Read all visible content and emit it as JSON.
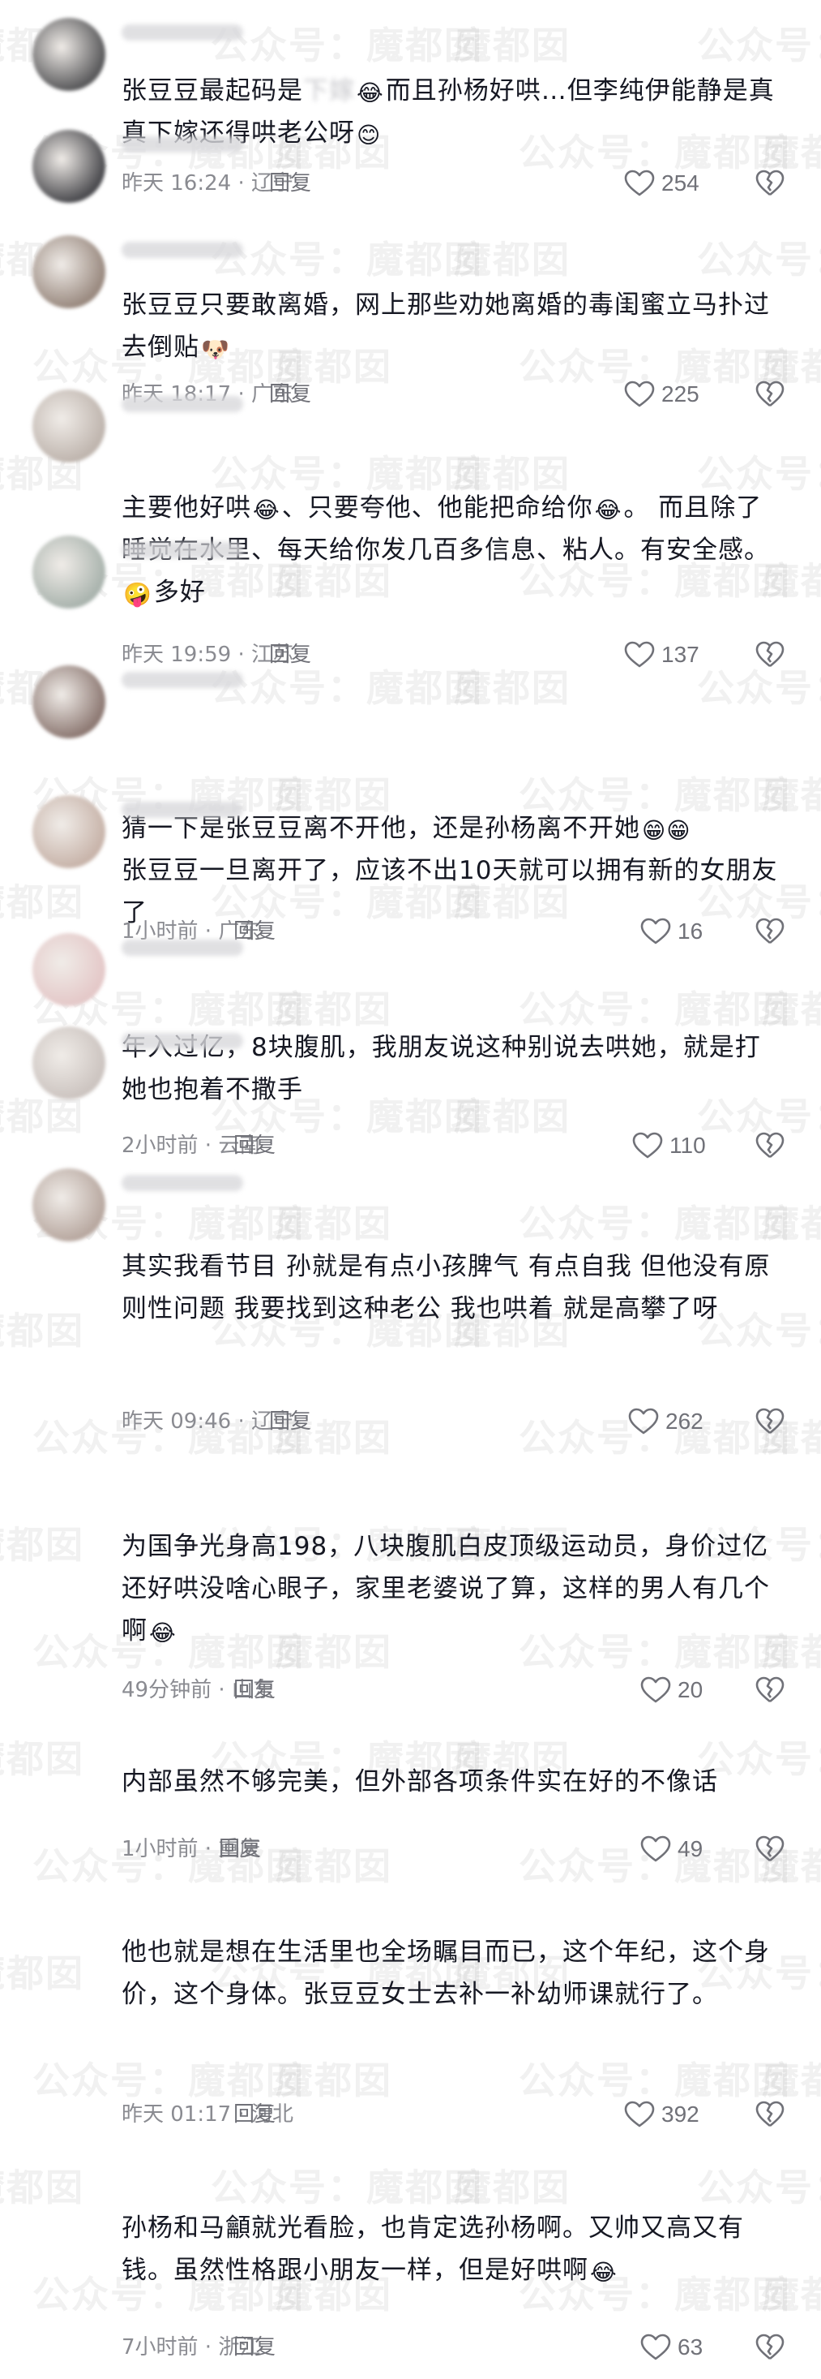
{
  "colors": {
    "text": "#161823",
    "meta": "#8a8b91",
    "icon": "#707178"
  },
  "watermark": [
    "魔都囡",
    "公众号：魔都囡"
  ],
  "comments": [
    {
      "text_parts": [
        "张豆豆最起码是",
        "下嫁",
        "😂",
        "而且孙杨好哄…但李纯伊能静是真真下嫁还得哄老公呀",
        "😊"
      ],
      "time": "昨天 16:24 · 辽宁",
      "reply": "回复",
      "likes": "254"
    },
    {
      "text_parts": [
        "张豆豆只要敢离婚，网上那些劝她离婚的毒闺蜜立马扑过去倒贴",
        "🐶"
      ],
      "time": "昨天 18:17 · 广东",
      "reply": "回复",
      "likes": "225"
    },
    {
      "text_parts": [
        "主要他好哄",
        "😂",
        "、只要夸他、他能把命给你",
        "😂",
        "。 而且除了睡觉在水里、每天给你发几百多信息、粘人。有安全感。 ",
        "🤪",
        "多好"
      ],
      "time": "昨天 19:59 · 江苏",
      "reply": "回复",
      "likes": "137"
    },
    {
      "text_parts": [
        "猜一下是张豆豆离不开他，还是孙杨离不开她",
        "😁😁",
        "\n张豆豆一旦离开了，应该不出10天就可以拥有新的女朋友了"
      ],
      "time": "1小时前 · 广东",
      "reply": "回复",
      "likes": "16"
    },
    {
      "text_parts": [
        "年入过亿，8块腹肌，我朋友说这种别说去哄她，就是打她也抱着不撒手"
      ],
      "time": "2小时前 · 云南",
      "reply": "回复",
      "likes": "110"
    },
    {
      "text_parts": [
        "其实我看节目 孙就是有点小孩脾气 有点自我 但他没有原则性问题 我要找到这种老公 我也哄着 就是高攀了呀"
      ],
      "time": "昨天 09:46 · 辽宁",
      "reply": "回复",
      "likes": "262"
    },
    {
      "text_parts": [
        "为国争光身高198，八块腹肌白皮顶级运动员，身价过亿还好哄没啥心眼子，家里老婆说了算，这样的男人有几个啊",
        "😂"
      ],
      "time": "49分钟前 · 山东",
      "reply": "回复",
      "likes": "20"
    },
    {
      "text_parts": [
        "内部虽然不够完美，但外部各项条件实在好的不像话"
      ],
      "time": "1小时前 · 重庆",
      "reply": "回复",
      "likes": "49"
    },
    {
      "text_parts": [
        "他也就是想在生活里也全场瞩目而已，这个年纪，这个身价，这个身体。张豆豆女士去补一补幼师课就行了。"
      ],
      "time": "昨天 01:17 · 河北",
      "reply": "回复",
      "likes": "392"
    },
    {
      "text_parts": [
        "孙杨和马龥就光看脸，也肯定选孙杨啊。又帅又高又有钱。虽然性格跟小朋友一样，但是好哄啊",
        "😂"
      ],
      "time": "7小时前 · 浙江",
      "reply": "回复",
      "likes": "63"
    }
  ]
}
